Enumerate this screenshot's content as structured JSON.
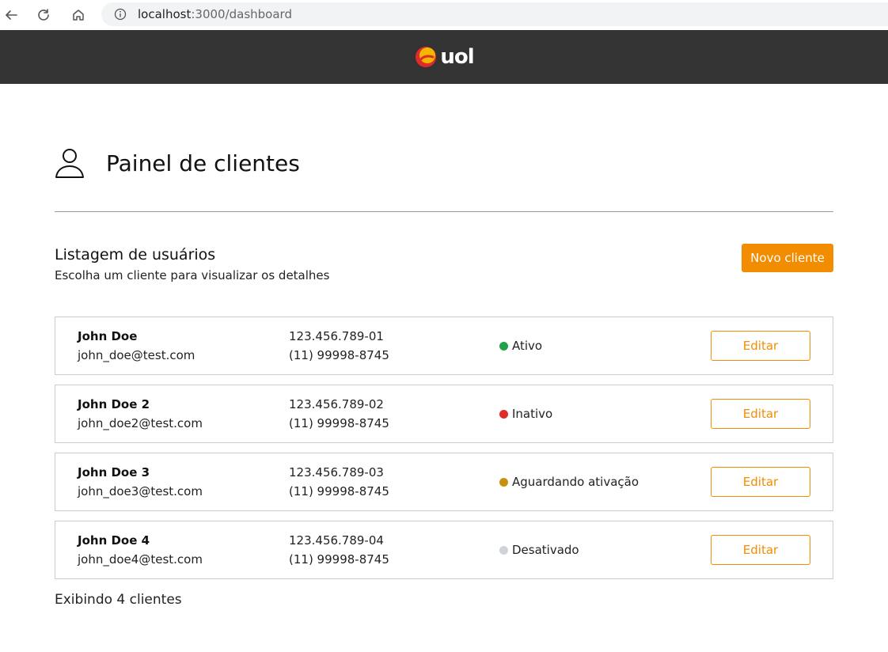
{
  "browser": {
    "url_host": "localhost",
    "url_path": ":3000/dashboard"
  },
  "header": {
    "logo_text": "uol"
  },
  "page": {
    "title": "Painel de clientes"
  },
  "section": {
    "title": "Listagem de usuários",
    "subtitle": "Escolha um cliente para visualizar os detalhes",
    "new_client_label": "Novo cliente"
  },
  "clients": [
    {
      "name": "John Doe",
      "email": "john_doe@test.com",
      "cpf": "123.456.789-01",
      "phone": "(11) 99998-8745",
      "status": "Ativo",
      "status_color": "#1fa24a",
      "edit_label": "Editar"
    },
    {
      "name": "John Doe 2",
      "email": "john_doe2@test.com",
      "cpf": "123.456.789-02",
      "phone": "(11) 99998-8745",
      "status": "Inativo",
      "status_color": "#e02b2b",
      "edit_label": "Editar"
    },
    {
      "name": "John Doe 3",
      "email": "john_doe3@test.com",
      "cpf": "123.456.789-03",
      "phone": "(11) 99998-8745",
      "status": "Aguardando ativação",
      "status_color": "#c8900e",
      "edit_label": "Editar"
    },
    {
      "name": "John Doe 4",
      "email": "john_doe4@test.com",
      "cpf": "123.456.789-04",
      "phone": "(11) 99998-8745",
      "status": "Desativado",
      "status_color": "#d0d4d8",
      "edit_label": "Editar"
    }
  ],
  "footer": {
    "count_text": "Exibindo 4 clientes"
  },
  "colors": {
    "accent": "#f28c00",
    "header_bg": "#333333"
  },
  "icons": {
    "back": "back-arrow-icon",
    "reload": "reload-icon",
    "home": "home-icon",
    "site_info": "site-info-icon",
    "page_title": "user-icon"
  }
}
